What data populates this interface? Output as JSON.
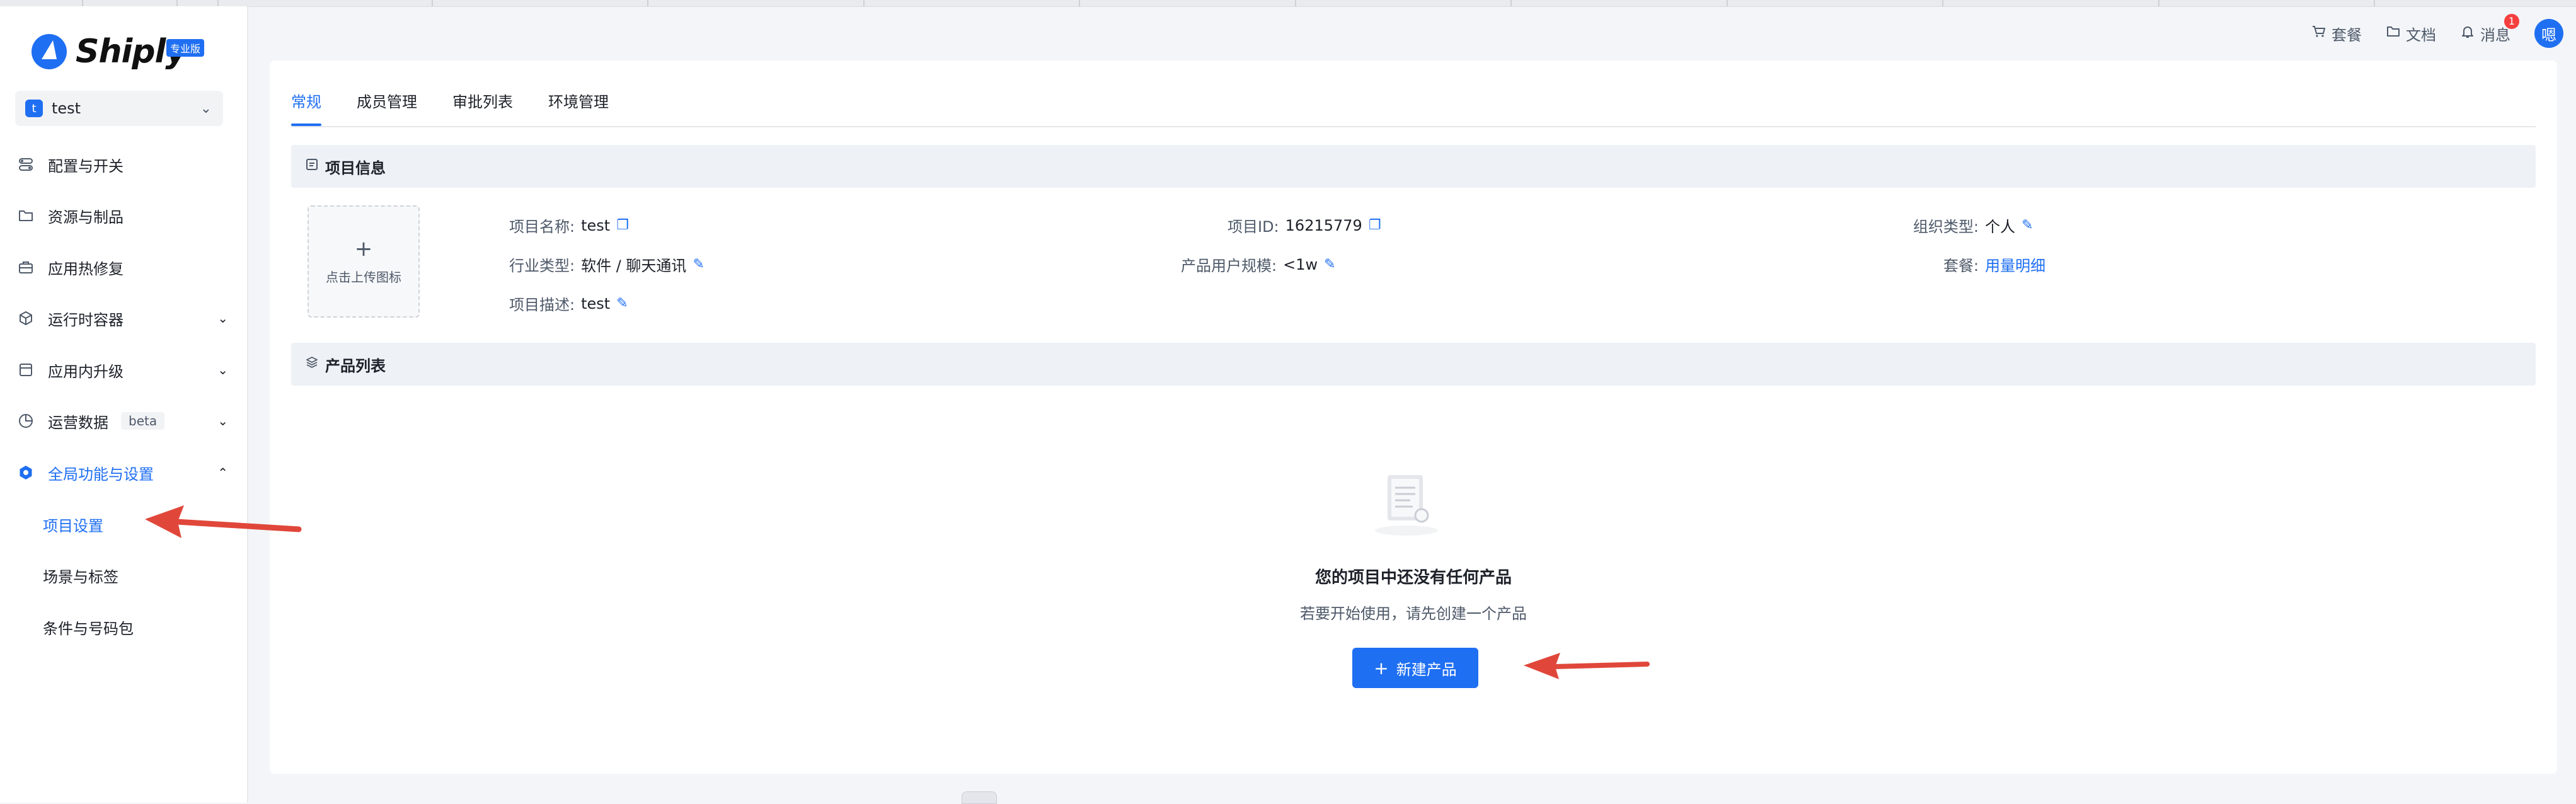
{
  "brand": {
    "name": "Shiply",
    "edition_badge": "专业版"
  },
  "project_selector": {
    "avatar_letter": "t",
    "name": "test"
  },
  "sidebar": {
    "items": [
      {
        "label": "配置与开关",
        "icon": "toggle-icon",
        "expandable": false
      },
      {
        "label": "资源与制品",
        "icon": "folder-icon",
        "expandable": false
      },
      {
        "label": "应用热修复",
        "icon": "toolbox-icon",
        "expandable": false
      },
      {
        "label": "运行时容器",
        "icon": "cube-icon",
        "expandable": true
      },
      {
        "label": "应用内升级",
        "icon": "package-icon",
        "expandable": true
      },
      {
        "label": "运营数据",
        "icon": "pie-chart-icon",
        "expandable": true,
        "badge": "beta"
      },
      {
        "label": "全局功能与设置",
        "icon": "settings-icon",
        "expandable": true,
        "expanded": true,
        "active": true
      }
    ],
    "subitems": [
      {
        "label": "项目设置",
        "active": true
      },
      {
        "label": "场景与标签",
        "active": false
      },
      {
        "label": "条件与号码包",
        "active": false
      }
    ]
  },
  "header": {
    "plan_label": "套餐",
    "docs_label": "文档",
    "messages_label": "消息",
    "messages_count": "1",
    "user_avatar": "嗯"
  },
  "tabs": [
    {
      "label": "常规",
      "active": true
    },
    {
      "label": "成员管理",
      "active": false
    },
    {
      "label": "审批列表",
      "active": false
    },
    {
      "label": "环境管理",
      "active": false
    }
  ],
  "project_info": {
    "section_title": "项目信息",
    "upload_label": "点击上传图标",
    "upload_plus": "+",
    "name_key": "项目名称:",
    "name_value": "test",
    "id_key": "项目ID:",
    "id_value": "16215779",
    "org_key": "组织类型:",
    "org_value": "个人",
    "industry_key": "行业类型:",
    "industry_value": "软件 / 聊天通讯",
    "scale_key": "产品用户规模:",
    "scale_value": "<1w",
    "plan_key": "套餐:",
    "plan_value": "用量明细",
    "desc_key": "项目描述:",
    "desc_value": "test"
  },
  "product_list": {
    "section_title": "产品列表",
    "empty_title": "您的项目中还没有任何产品",
    "empty_subtitle": "若要开始使用，请先创建一个产品",
    "new_button_label": "新建产品",
    "new_button_icon": "plus-icon"
  },
  "colors": {
    "accent": "#1f6ff2",
    "annotation_arrow": "#e0473a",
    "section_bg": "#eef1f5",
    "page_bg": "#f3f5f8"
  }
}
